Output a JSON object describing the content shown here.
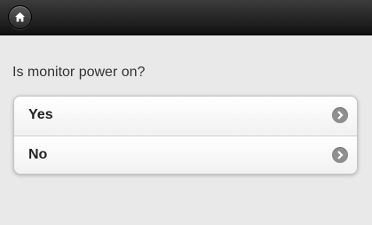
{
  "header": {
    "home_icon": "home-icon"
  },
  "question": "Is monitor power on?",
  "options": [
    {
      "label": "Yes",
      "icon": "chevron-right-icon"
    },
    {
      "label": "No",
      "icon": "chevron-right-icon"
    }
  ],
  "colors": {
    "header_dark": "#111111",
    "page_bg": "#e9e9e9",
    "arrow_bg": "#8f8f8f"
  }
}
